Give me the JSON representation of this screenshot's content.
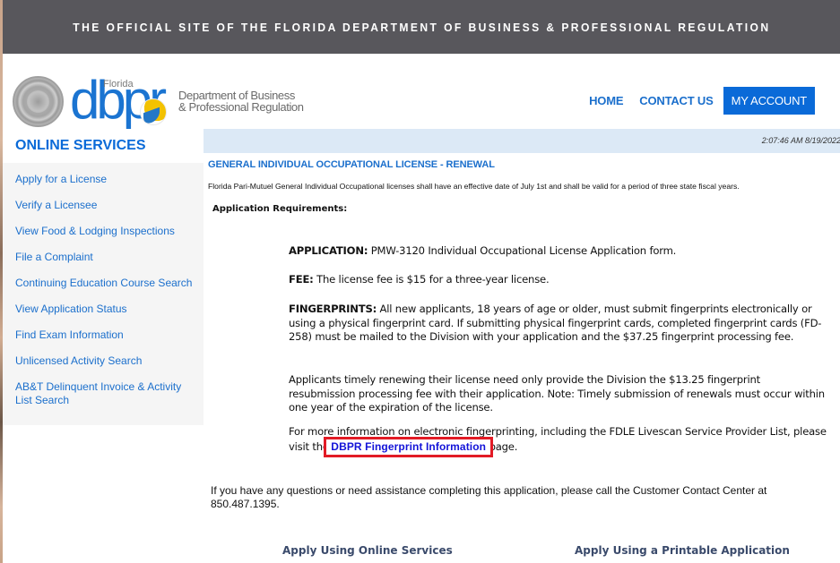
{
  "banner": {
    "text": "THE OFFICIAL SITE OF THE FLORIDA DEPARTMENT OF BUSINESS & PROFESSIONAL REGULATION"
  },
  "logo": {
    "state": "Florida",
    "acronym": "dbpr",
    "department_line1": "Department of Business",
    "department_line2": "& Professional Regulation",
    "seal_icon": "florida-state-seal-icon"
  },
  "nav": {
    "home": "HOME",
    "contact": "CONTACT US",
    "account": "MY ACCOUNT"
  },
  "colors": {
    "accent": "#0a6ad8",
    "link": "#1b6fcc",
    "banner_bg": "#58575c",
    "timebar_bg": "#dce9f6",
    "highlight_border": "#e21b25"
  },
  "sidebar": {
    "title": "ONLINE SERVICES",
    "items": [
      {
        "label": "Apply for a License"
      },
      {
        "label": "Verify a Licensee"
      },
      {
        "label": "View Food & Lodging Inspections"
      },
      {
        "label": "File a Complaint"
      },
      {
        "label": "Continuing Education Course Search"
      },
      {
        "label": "View Application Status"
      },
      {
        "label": "Find Exam Information"
      },
      {
        "label": "Unlicensed Activity Search"
      },
      {
        "label": "AB&T Delinquent Invoice & Activity List Search"
      }
    ]
  },
  "main": {
    "timestamp": "2:07:46 AM 8/19/2022",
    "title": "GENERAL INDIVIDUAL OCCUPATIONAL LICENSE - RENEWAL",
    "intro": "Florida Pari-Mutuel General Individual Occupational licenses shall have an effective date of July 1st and shall be valid for a period of three state fiscal years.",
    "requirements_label": "Application Requirements:",
    "application": {
      "label": "APPLICATION:",
      "text": " PMW-3120 Individual Occupational License Application form."
    },
    "fee": {
      "label": "FEE:",
      "text": " The license fee is $15 for a three-year license."
    },
    "fingerprints": {
      "label": "FINGERPRINTS:",
      "text": " All new applicants, 18 years of age or older, must submit fingerprints electronically or using a physical fingerprint card. If submitting physical fingerprint cards, completed fingerprint cards (FD-258) must be mailed to the Division with your application and the $37.25 fingerprint processing fee."
    },
    "renewal_note": "Applicants timely renewing their license need only provide the Division the $13.25 fingerprint resubmission processing fee with their application. Note: Timely submission of renewals must occur within one year of the expiration of the license.",
    "more_info_before": "For more information on electronic fingerprinting, including the FDLE Livescan Service Provider List, please visit the ",
    "fingerprint_link": "DBPR Fingerprint Information",
    "more_info_after": " page.",
    "contact": "If you have any questions or need assistance completing this application, please call the Customer Contact Center at 850.487.1395.",
    "apply_online": "Apply Using Online Services",
    "apply_printable": "Apply Using a Printable Application"
  }
}
